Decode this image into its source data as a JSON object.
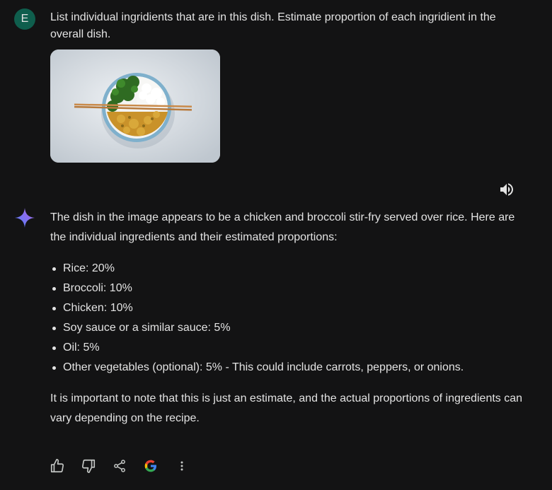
{
  "user": {
    "avatar_letter": "E",
    "prompt": "List individual ingridients that are in this dish. Estimate proportion of each ingridient in the overall dish."
  },
  "response": {
    "intro": "The dish in the image appears to be a chicken and broccoli stir-fry served over rice. Here are the individual ingredients and their estimated proportions:",
    "ingredients": [
      "Rice: 20%",
      "Broccoli: 10%",
      "Chicken: 10%",
      "Soy sauce or a similar sauce: 5%",
      "Oil: 5%",
      "Other vegetables (optional): 5% - This could include carrots, peppers, or onions."
    ],
    "outro": "It is important to note that this is just an estimate, and the actual proportions of ingredients can vary depending on the recipe."
  },
  "actions": {
    "icons": [
      "thumbs-up-icon",
      "thumbs-down-icon",
      "share-icon",
      "google-g-icon",
      "more-vert-icon"
    ]
  },
  "colors": {
    "background": "#131314",
    "text": "#e3e3e3",
    "avatar": "#0f5e4d"
  }
}
